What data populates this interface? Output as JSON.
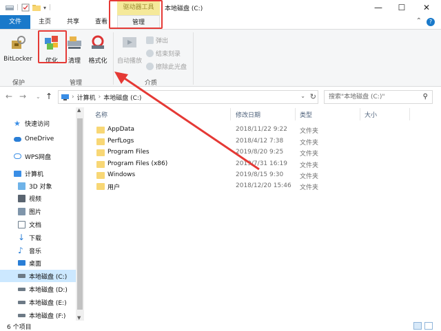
{
  "titlebar": {
    "context_tab": "驱动器工具",
    "title": "本地磁盘 (C:)",
    "minimize": "—",
    "maximize": "☐",
    "close": "✕"
  },
  "tabs": {
    "file": "文件",
    "home": "主页",
    "share": "共享",
    "view": "查看",
    "manage": "管理"
  },
  "ribbon": {
    "bitlocker": "BitLocker",
    "optimize": "优化",
    "cleanup": "清理",
    "format": "格式化",
    "autoplay": "自动播放",
    "eject": "弹出",
    "finish_burn": "结束刻录",
    "erase_disc": "擦除此光盘",
    "group_protect": "保护",
    "group_manage": "管理",
    "group_media": "介质"
  },
  "address": {
    "crumb1": "计算机",
    "crumb2": "本地磁盘 (C:)",
    "search_placeholder": "搜索\"本地磁盘 (C:)\""
  },
  "nav": {
    "items": [
      {
        "label": "快速访问"
      },
      {
        "label": "OneDrive"
      },
      {
        "label": "WPS网盘"
      },
      {
        "label": "计算机"
      },
      {
        "label": "3D 对象"
      },
      {
        "label": "视频"
      },
      {
        "label": "图片"
      },
      {
        "label": "文档"
      },
      {
        "label": "下载"
      },
      {
        "label": "音乐"
      },
      {
        "label": "桌面"
      },
      {
        "label": "本地磁盘 (C:)"
      },
      {
        "label": "本地磁盘 (D:)"
      },
      {
        "label": "本地磁盘 (E:)"
      },
      {
        "label": "本地磁盘 (F:)"
      }
    ]
  },
  "columns": {
    "name": "名称",
    "date": "修改日期",
    "type": "类型",
    "size": "大小"
  },
  "files": [
    {
      "name": "AppData",
      "date": "2018/11/22 9:22",
      "type": "文件夹"
    },
    {
      "name": "PerfLogs",
      "date": "2018/4/12 7:38",
      "type": "文件夹"
    },
    {
      "name": "Program Files",
      "date": "2019/8/20 9:25",
      "type": "文件夹"
    },
    {
      "name": "Program Files (x86)",
      "date": "2019/7/31 16:19",
      "type": "文件夹"
    },
    {
      "name": "Windows",
      "date": "2019/8/15 9:30",
      "type": "文件夹"
    },
    {
      "name": "用户",
      "date": "2018/12/20 15:46",
      "type": "文件夹"
    }
  ],
  "status": {
    "count": "6 个项目"
  },
  "colors": {
    "accent": "#1979ca",
    "highlight": "#e53935",
    "context_tab": "#f5e99a"
  }
}
